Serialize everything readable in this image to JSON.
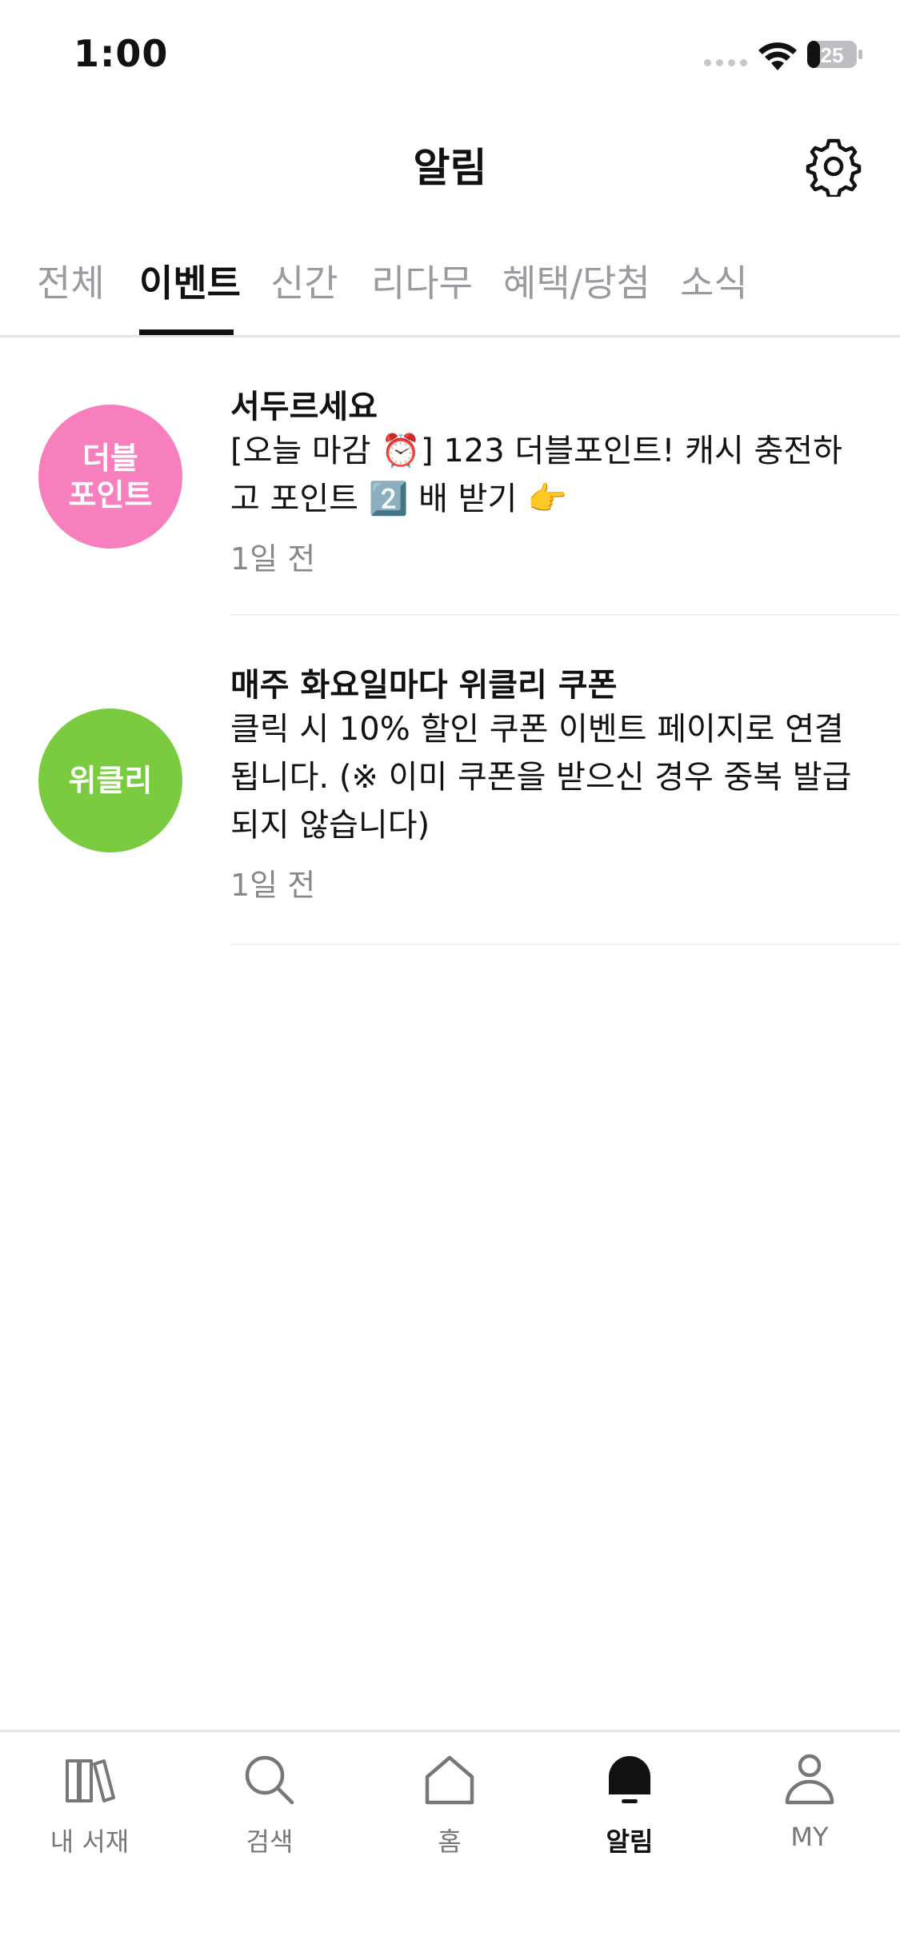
{
  "status": {
    "time": "1:00",
    "battery": "25"
  },
  "header": {
    "title": "알림",
    "settings_icon": "gear-icon"
  },
  "tabs": [
    {
      "label": "전체",
      "active": false
    },
    {
      "label": "이벤트",
      "active": true
    },
    {
      "label": "신간",
      "active": false
    },
    {
      "label": "리다무",
      "active": false
    },
    {
      "label": "혜택/당첨",
      "active": false
    },
    {
      "label": "소식",
      "active": false
    }
  ],
  "notifications": [
    {
      "avatar_text": "더블\n포인트",
      "avatar_color": "#F77FBE",
      "title": "서두르세요",
      "body": "[오늘 마감 ⏰] 123 더블포인트! 캐시 충전하고 포인트 2️⃣ 배 받기 👉",
      "time": "1일 전"
    },
    {
      "avatar_text": "위클리",
      "avatar_color": "#7ACB3F",
      "title": "매주 화요일마다 위클리 쿠폰",
      "body": "클릭 시 10% 할인 쿠폰 이벤트 페이지로 연결됩니다. (※ 이미 쿠폰을 받으신 경우 중복 발급되지 않습니다)",
      "time": "1일 전"
    }
  ],
  "bottom_nav": [
    {
      "label": "내 서재",
      "icon": "library-icon",
      "active": false
    },
    {
      "label": "검색",
      "icon": "search-icon",
      "active": false
    },
    {
      "label": "홈",
      "icon": "home-icon",
      "active": false
    },
    {
      "label": "알림",
      "icon": "bell-icon",
      "active": true
    },
    {
      "label": "MY",
      "icon": "person-icon",
      "active": false
    }
  ]
}
